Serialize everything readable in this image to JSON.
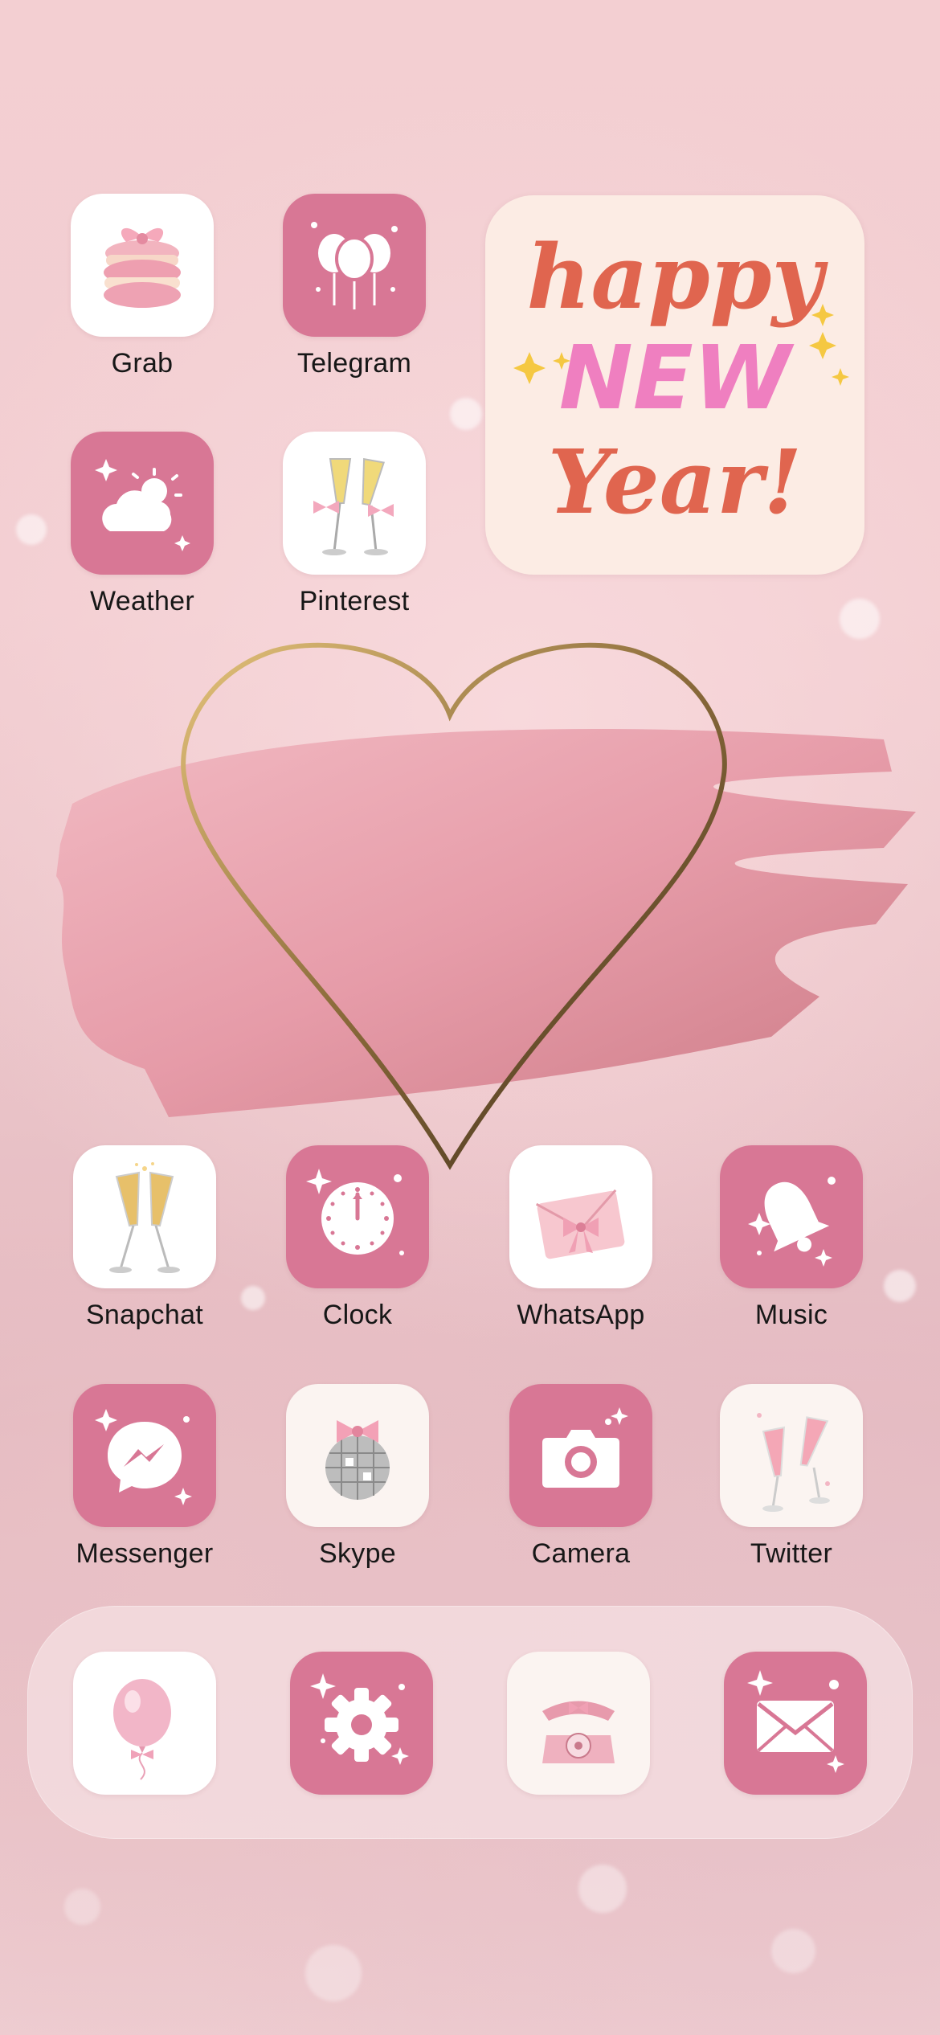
{
  "apps": [
    {
      "id": "grab",
      "label": "Grab",
      "icon": "macaron-icon"
    },
    {
      "id": "telegram",
      "label": "Telegram",
      "icon": "balloons-icon"
    },
    {
      "id": "weather",
      "label": "Weather",
      "icon": "cloud-sun-icon"
    },
    {
      "id": "pinterest",
      "label": "Pinterest",
      "icon": "champagne-bows-icon"
    },
    {
      "id": "snapchat",
      "label": "Snapchat",
      "icon": "champagne-flutes-icon"
    },
    {
      "id": "clock",
      "label": "Clock",
      "icon": "clock-icon"
    },
    {
      "id": "whatsapp",
      "label": "WhatsApp",
      "icon": "envelope-bow-icon"
    },
    {
      "id": "music",
      "label": "Music",
      "icon": "bell-icon"
    },
    {
      "id": "messenger",
      "label": "Messenger",
      "icon": "messenger-bolt-icon"
    },
    {
      "id": "skype",
      "label": "Skype",
      "icon": "disco-ball-icon"
    },
    {
      "id": "camera",
      "label": "Camera",
      "icon": "camera-icon"
    },
    {
      "id": "twitter",
      "label": "Twitter",
      "icon": "pink-flutes-icon"
    }
  ],
  "widget": {
    "line1": "happy",
    "line2": "NEW",
    "line3": "Year!"
  },
  "dock": [
    {
      "id": "dock-balloon",
      "icon": "balloon-icon"
    },
    {
      "id": "dock-settings",
      "icon": "gear-icon"
    },
    {
      "id": "dock-phone",
      "icon": "telephone-icon"
    },
    {
      "id": "dock-mail",
      "icon": "mail-icon"
    }
  ],
  "colors": {
    "tile_pink": "#d87795",
    "widget_bg": "#fcece4",
    "script_red": "#e0654f",
    "new_pink": "#ef7fc0",
    "heart_gold": "#b89554"
  }
}
